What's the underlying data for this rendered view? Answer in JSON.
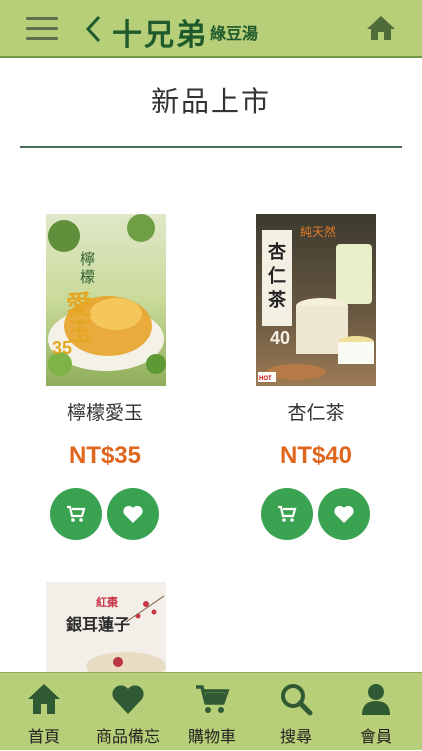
{
  "header": {
    "brand_main": "十兄弟",
    "brand_sub": "綠豆湯"
  },
  "page": {
    "title": "新品上市"
  },
  "products": [
    {
      "name": "檸檬愛玉",
      "price": "NT$35",
      "image_text": "檸檬愛玉 35"
    },
    {
      "name": "杏仁茶",
      "price": "NT$40",
      "image_text": "純天然 杏仁茶 40"
    },
    {
      "name": "",
      "price": "",
      "image_text": "紅棗 銀耳蓮子"
    }
  ],
  "bottom_nav": {
    "items": [
      {
        "label": "首頁",
        "icon": "home-icon"
      },
      {
        "label": "商品備忘",
        "icon": "heart-icon"
      },
      {
        "label": "購物車",
        "icon": "cart-icon"
      },
      {
        "label": "搜尋",
        "icon": "search-icon"
      },
      {
        "label": "會員",
        "icon": "user-icon"
      }
    ]
  },
  "colors": {
    "header_bg": "#b6cf78",
    "brand": "#1f5a2c",
    "price": "#e0661e",
    "action_button": "#3aa351"
  }
}
